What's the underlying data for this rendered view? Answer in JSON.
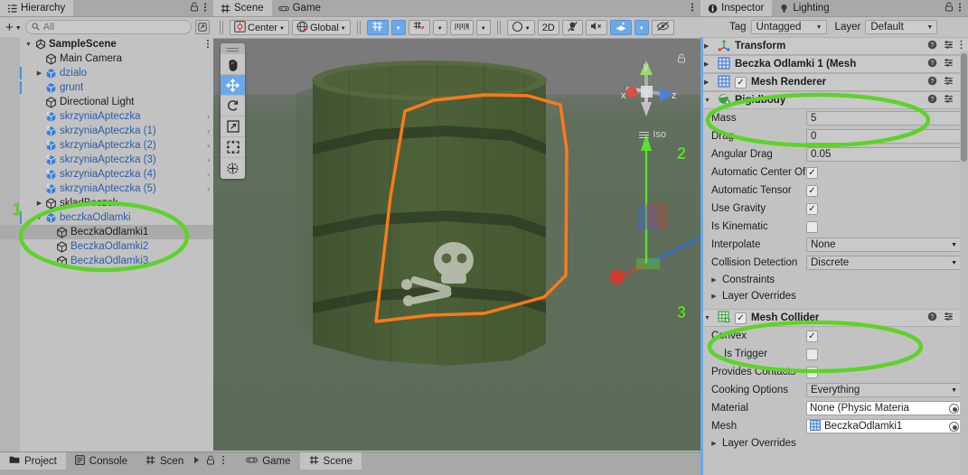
{
  "hierarchy": {
    "tab_label": "Hierarchy",
    "tab_icon": "hierarchy-icon",
    "lock_icon": "lock-icon",
    "menu_icon": "kebab-menu-icon",
    "add_label": "+",
    "search": {
      "placeholder": "All",
      "value": "",
      "icon": "search-icon"
    },
    "scene_root": {
      "label": "SampleScene",
      "icon": "unity-scene-icon",
      "menu_icon": "kebab-menu-icon"
    },
    "items": [
      {
        "label": "Main Camera",
        "icon": "gameobject-icon",
        "depth": 2,
        "arrow": "",
        "prefab": false,
        "chevron": false,
        "selected": false,
        "prefabline": false
      },
      {
        "label": "dzialo",
        "icon": "prefab-icon",
        "depth": 2,
        "arrow": "▶",
        "prefab": true,
        "chevron": false,
        "selected": false,
        "prefabline": true
      },
      {
        "label": "grunt",
        "icon": "prefab-icon",
        "depth": 2,
        "arrow": "",
        "prefab": true,
        "chevron": false,
        "selected": false,
        "prefabline": true
      },
      {
        "label": "Directional Light",
        "icon": "gameobject-icon",
        "depth": 2,
        "arrow": "",
        "prefab": false,
        "chevron": false,
        "selected": false,
        "prefabline": false
      },
      {
        "label": "skrzyniaApteczka",
        "icon": "prefab-variant-icon",
        "depth": 2,
        "arrow": "",
        "prefab": true,
        "chevron": true,
        "selected": false,
        "prefabline": false
      },
      {
        "label": "skrzyniaApteczka (1)",
        "icon": "prefab-variant-icon",
        "depth": 2,
        "arrow": "",
        "prefab": true,
        "chevron": true,
        "selected": false,
        "prefabline": false
      },
      {
        "label": "skrzyniaApteczka (2)",
        "icon": "prefab-variant-icon",
        "depth": 2,
        "arrow": "",
        "prefab": true,
        "chevron": true,
        "selected": false,
        "prefabline": false
      },
      {
        "label": "skrzyniaApteczka (3)",
        "icon": "prefab-variant-icon",
        "depth": 2,
        "arrow": "",
        "prefab": true,
        "chevron": true,
        "selected": false,
        "prefabline": false
      },
      {
        "label": "skrzyniaApteczka (4)",
        "icon": "prefab-variant-icon",
        "depth": 2,
        "arrow": "",
        "prefab": true,
        "chevron": true,
        "selected": false,
        "prefabline": false
      },
      {
        "label": "skrzyniaApteczka (5)",
        "icon": "prefab-variant-icon",
        "depth": 2,
        "arrow": "",
        "prefab": true,
        "chevron": true,
        "selected": false,
        "prefabline": false
      },
      {
        "label": "skladBeczek",
        "icon": "gameobject-icon",
        "depth": 2,
        "arrow": "▶",
        "prefab": false,
        "chevron": false,
        "selected": false,
        "prefabline": false
      },
      {
        "label": "beczkaOdlamki",
        "icon": "prefab-icon",
        "depth": 2,
        "arrow": "▼",
        "prefab": true,
        "chevron": false,
        "selected": false,
        "prefabline": true
      },
      {
        "label": "BeczkaOdlamki1",
        "icon": "gameobject-icon",
        "depth": 3,
        "arrow": "",
        "prefab": false,
        "chevron": false,
        "selected": true,
        "prefabline": false
      },
      {
        "label": "BeczkaOdlamki2",
        "icon": "gameobject-icon",
        "depth": 3,
        "arrow": "",
        "prefab": true,
        "chevron": false,
        "selected": false,
        "prefabline": false
      },
      {
        "label": "BeczkaOdlamki3",
        "icon": "gameobject-icon",
        "depth": 3,
        "arrow": "",
        "prefab": true,
        "chevron": false,
        "selected": false,
        "prefabline": false
      }
    ]
  },
  "scene": {
    "tabs": [
      {
        "label": "Scene",
        "icon": "scene-grid-icon",
        "active": true
      },
      {
        "label": "Game",
        "icon": "game-pad-icon",
        "active": false
      }
    ],
    "menu_icon": "kebab-menu-icon",
    "toolbar": {
      "pivot_label": "Center",
      "pivot_icon": "pivot-center-icon",
      "space_label": "Global",
      "space_icon": "globe-icon",
      "grid_icon": "grid-y-axis-icon",
      "snap_icon": "snap-magnet-icon",
      "ruler_icon": "ruler-icon",
      "shading_icon": "shading-sphere-icon",
      "twod_label": "2D",
      "light_icon": "light-off-icon",
      "audio_icon": "audio-mute-icon",
      "fx_icon": "effects-icon",
      "hidden_icon": "visibility-off-icon",
      "caret": "▾"
    },
    "tools": [
      {
        "name": "hand-tool",
        "glyph": "hand",
        "active": false
      },
      {
        "name": "move-tool",
        "glyph": "move",
        "active": true
      },
      {
        "name": "rotate-tool",
        "glyph": "rotate",
        "active": false
      },
      {
        "name": "scale-tool",
        "glyph": "scale",
        "active": false
      },
      {
        "name": "rect-tool",
        "glyph": "rect",
        "active": false
      },
      {
        "name": "transform-tool",
        "glyph": "xform",
        "active": false
      }
    ],
    "gizmo": {
      "x_label": "x",
      "y_label": "y",
      "z_label": "z",
      "projection_label": "Iso",
      "lock_icon": "lock-icon"
    },
    "object": {
      "name": "BeczkaOdlamki1",
      "selection_outline_color": "#ff7a18",
      "barrel_color": "#465a33",
      "gizmo_axis_colors": {
        "x": "#d23b2e",
        "y": "#5ddf2b",
        "z": "#2a6fe0"
      }
    }
  },
  "inspector": {
    "tabs": [
      {
        "label": "Inspector",
        "icon": "info-circle-icon",
        "active": true
      },
      {
        "label": "Lighting",
        "icon": "lightbulb-icon",
        "active": false
      }
    ],
    "lock_icon": "lock-icon",
    "menu_icon": "kebab-menu-icon",
    "tag": {
      "label": "Tag",
      "value": "Untagged"
    },
    "layer": {
      "label": "Layer",
      "value": "Default"
    },
    "components": [
      {
        "name": "Transform",
        "icon": "transform-icon",
        "folded": true,
        "has_toggle": false,
        "enabled": false
      },
      {
        "name": "Beczka Odlamki 1 (Mesh",
        "icon": "mesh-filter-icon",
        "folded": true,
        "has_toggle": false,
        "enabled": false
      },
      {
        "name": "Mesh Renderer",
        "icon": "mesh-renderer-icon",
        "folded": true,
        "has_toggle": true,
        "enabled": true
      },
      {
        "name": "Rigidbody",
        "icon": "rigidbody-icon",
        "folded": false,
        "has_toggle": false,
        "enabled": false
      },
      {
        "name": "Mesh Collider",
        "icon": "mesh-collider-icon",
        "folded": false,
        "has_toggle": true,
        "enabled": true
      }
    ],
    "help_icon": "help-circle-icon",
    "preset_icon": "preset-sliders-icon",
    "kebab_icon": "kebab-menu-icon",
    "rigidbody": {
      "mass": {
        "label": "Mass",
        "type": "text",
        "value": "5"
      },
      "drag": {
        "label": "Drag",
        "type": "text",
        "value": "0"
      },
      "angular_drag": {
        "label": "Angular Drag",
        "type": "text",
        "value": "0.05"
      },
      "auto_center": {
        "label": "Automatic Center Of",
        "type": "checkbox",
        "checked": true
      },
      "auto_tensor": {
        "label": "Automatic Tensor",
        "type": "checkbox",
        "checked": true
      },
      "use_gravity": {
        "label": "Use Gravity",
        "type": "checkbox",
        "checked": true
      },
      "is_kinematic": {
        "label": "Is Kinematic",
        "type": "checkbox",
        "checked": false
      },
      "interpolate": {
        "label": "Interpolate",
        "type": "dropdown",
        "value": "None"
      },
      "collision_detection": {
        "label": "Collision Detection",
        "type": "dropdown",
        "value": "Discrete"
      },
      "constraints": {
        "label": "Constraints",
        "type": "foldout"
      },
      "layer_overrides": {
        "label": "Layer Overrides",
        "type": "foldout"
      }
    },
    "mesh_collider": {
      "convex": {
        "label": "Convex",
        "type": "checkbox",
        "checked": true
      },
      "is_trigger": {
        "label": "Is Trigger",
        "type": "checkbox",
        "checked": false
      },
      "provides_contacts": {
        "label": "Provides Contacts",
        "type": "checkbox",
        "checked": false
      },
      "cooking_options": {
        "label": "Cooking Options",
        "type": "dropdown",
        "value": "Everything"
      },
      "material": {
        "label": "Material",
        "type": "object",
        "value": "None (Physic Materia"
      },
      "mesh": {
        "label": "Mesh",
        "type": "object",
        "value": "BeczkaOdlamki1"
      },
      "layer_overrides": {
        "label": "Layer Overrides",
        "type": "foldout"
      }
    }
  },
  "bottom_bar": {
    "tabs": [
      {
        "label": "Project",
        "icon": "folder-icon",
        "active": true
      },
      {
        "label": "Console",
        "icon": "console-icon",
        "active": false
      },
      {
        "label": "Scen",
        "icon": "scene-grid-icon",
        "active": false
      },
      {
        "label": "Game",
        "icon": "game-pad-icon",
        "active": false
      },
      {
        "label": "Scene",
        "icon": "scene-grid-icon",
        "active": true
      }
    ],
    "play_icon": "play-icon",
    "lock_icon": "lock-icon",
    "menu_icon": "kebab-menu-icon"
  },
  "annotations": {
    "color": "#5dd32a",
    "marks": [
      {
        "number": "1",
        "target": "hierarchy-children-group"
      },
      {
        "number": "2",
        "target": "rigidbody-component"
      },
      {
        "number": "3",
        "target": "mesh-collider-component"
      }
    ]
  }
}
